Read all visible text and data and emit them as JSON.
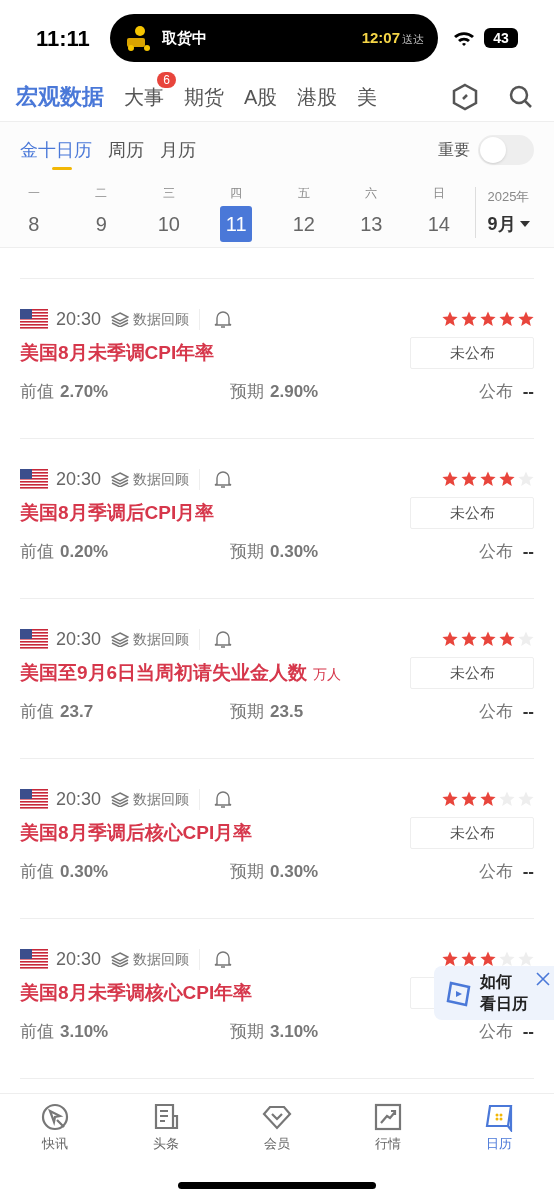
{
  "status_bar": {
    "time": "11:11",
    "activity_label": "取货中",
    "eta_time": "12:07",
    "eta_suffix": "送达",
    "battery": "43"
  },
  "top_tabs": [
    {
      "label": "宏观数据",
      "selected": true
    },
    {
      "label": "大事",
      "selected": false,
      "badge": "6"
    },
    {
      "label": "期货",
      "selected": false
    },
    {
      "label": "A股",
      "selected": false
    },
    {
      "label": "港股",
      "selected": false
    },
    {
      "label": "美",
      "selected": false
    }
  ],
  "sub_tabs": [
    {
      "label": "金十日历",
      "selected": true
    },
    {
      "label": "周历",
      "selected": false
    },
    {
      "label": "月历",
      "selected": false
    }
  ],
  "important_toggle": {
    "label": "重要",
    "on": false
  },
  "week": [
    {
      "weekday": "一",
      "day": "8",
      "selected": false
    },
    {
      "weekday": "二",
      "day": "9",
      "selected": false
    },
    {
      "weekday": "三",
      "day": "10",
      "selected": false
    },
    {
      "weekday": "四",
      "day": "11",
      "selected": true
    },
    {
      "weekday": "五",
      "day": "12",
      "selected": false
    },
    {
      "weekday": "六",
      "day": "13",
      "selected": false
    },
    {
      "weekday": "日",
      "day": "14",
      "selected": false
    }
  ],
  "month_picker": {
    "year": "2025年",
    "month": "9月"
  },
  "events": [
    {
      "time": "20:30",
      "review": "数据回顾",
      "stars": 5,
      "title": "美国8月未季调CPI年率",
      "status": "未公布",
      "previous_label": "前值",
      "previous": "2.70%",
      "forecast_label": "预期",
      "forecast": "2.90%",
      "actual_label": "公布",
      "actual": "--"
    },
    {
      "time": "20:30",
      "review": "数据回顾",
      "stars": 4,
      "title": "美国8月季调后CPI月率",
      "status": "未公布",
      "previous_label": "前值",
      "previous": "0.20%",
      "forecast_label": "预期",
      "forecast": "0.30%",
      "actual_label": "公布",
      "actual": "--"
    },
    {
      "time": "20:30",
      "review": "数据回顾",
      "stars": 4,
      "title": "美国至9月6日当周初请失业金人数",
      "unit": "万人",
      "status": "未公布",
      "previous_label": "前值",
      "previous": "23.7",
      "forecast_label": "预期",
      "forecast": "23.5",
      "actual_label": "公布",
      "actual": "--"
    },
    {
      "time": "20:30",
      "review": "数据回顾",
      "stars": 3,
      "title": "美国8月季调后核心CPI月率",
      "status": "未公布",
      "previous_label": "前值",
      "previous": "0.30%",
      "forecast_label": "预期",
      "forecast": "0.30%",
      "actual_label": "公布",
      "actual": "--"
    },
    {
      "time": "20:30",
      "review": "数据回顾",
      "stars": 3,
      "title": "美国8月未季调核心CPI年率",
      "previous_label": "前值",
      "previous": "3.10%",
      "forecast_label": "预期",
      "forecast": "3.10%",
      "actual_label": "公布",
      "actual": "--"
    }
  ],
  "help_popup": {
    "line_1": "如何",
    "line_2": "看日历"
  },
  "bottom_nav": [
    {
      "label": "快讯",
      "kind": "flash",
      "selected": false
    },
    {
      "label": "头条",
      "kind": "news",
      "selected": false
    },
    {
      "label": "会员",
      "kind": "vip",
      "selected": false
    },
    {
      "label": "行情",
      "kind": "market",
      "selected": false
    },
    {
      "label": "日历",
      "kind": "calendar",
      "selected": true
    }
  ]
}
